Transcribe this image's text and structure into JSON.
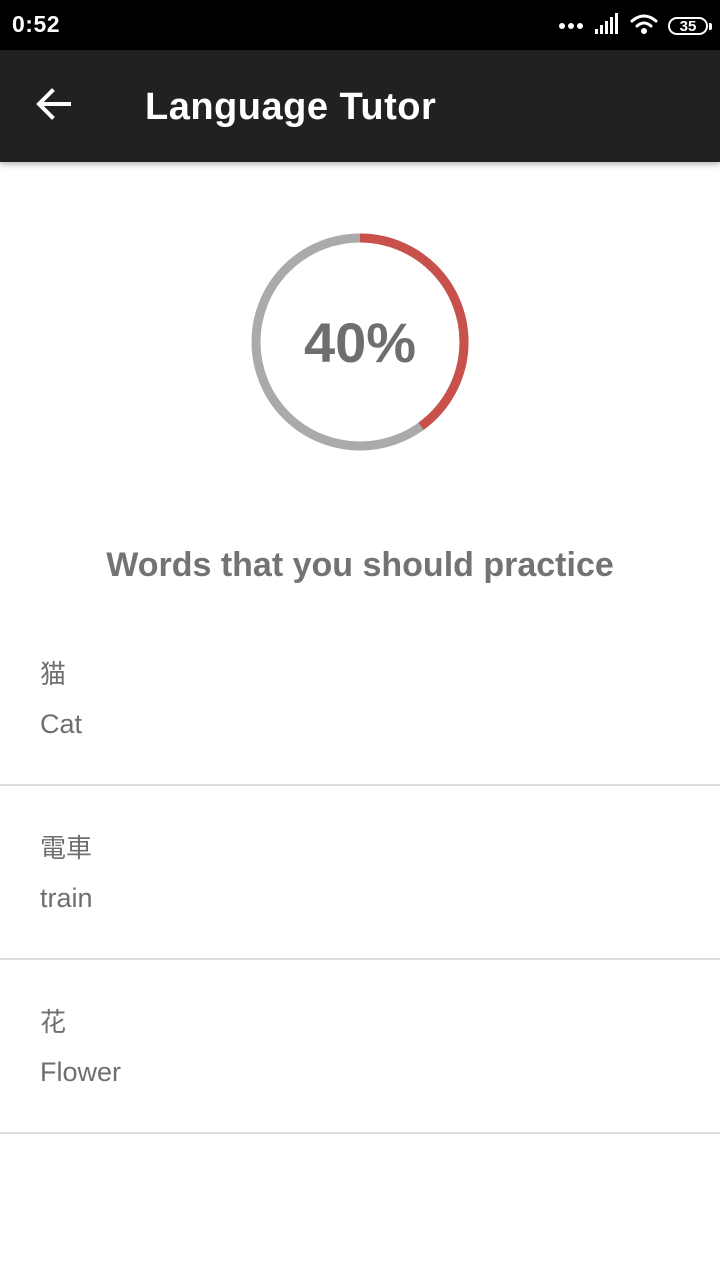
{
  "status_bar": {
    "time": "0:52",
    "battery_level": "35",
    "icons": [
      "more-dots-icon",
      "signal-icon",
      "wifi-icon",
      "battery-icon"
    ]
  },
  "app_bar": {
    "back_icon": "arrow-left-icon",
    "title": "Language Tutor"
  },
  "progress": {
    "value": 0.4,
    "label": "40%",
    "colors": {
      "fill": "#c9514b",
      "track": "#aaaaaa"
    }
  },
  "practice": {
    "heading": "Words that you should practice",
    "words": [
      {
        "native": "猫",
        "translation": "Cat"
      },
      {
        "native": "電車",
        "translation": "train"
      },
      {
        "native": "花",
        "translation": "Flower"
      }
    ]
  }
}
